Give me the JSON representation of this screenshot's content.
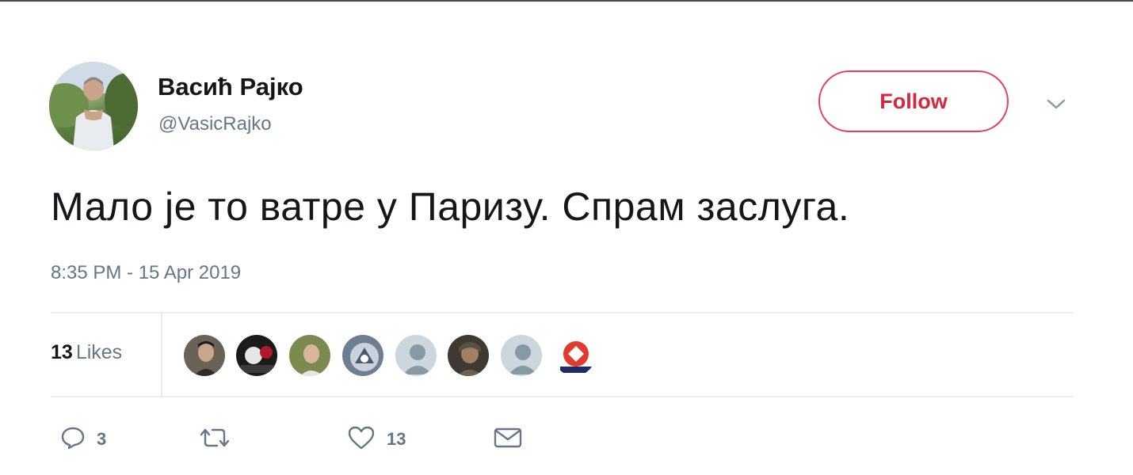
{
  "tweet": {
    "author": {
      "display_name": "Васић Рајко",
      "handle": "@VasicRajko"
    },
    "follow_label": "Follow",
    "text": "Мало је то ватре у Паризу. Спрам заслуга.",
    "timestamp": "8:35 PM - 15 Apr 2019",
    "likes": {
      "count": "13",
      "label": "Likes"
    },
    "actions": {
      "reply_count": "3",
      "retweet_count": "",
      "like_count": "13"
    }
  },
  "icons": {
    "caret": "chevron-down-icon",
    "reply": "reply-icon",
    "retweet": "retweet-icon",
    "like": "heart-icon",
    "message": "envelope-icon"
  },
  "colors": {
    "follow_accent": "#e1425a",
    "text_primary": "#14171a",
    "text_secondary": "#657786",
    "divider": "#e6ecf0"
  }
}
